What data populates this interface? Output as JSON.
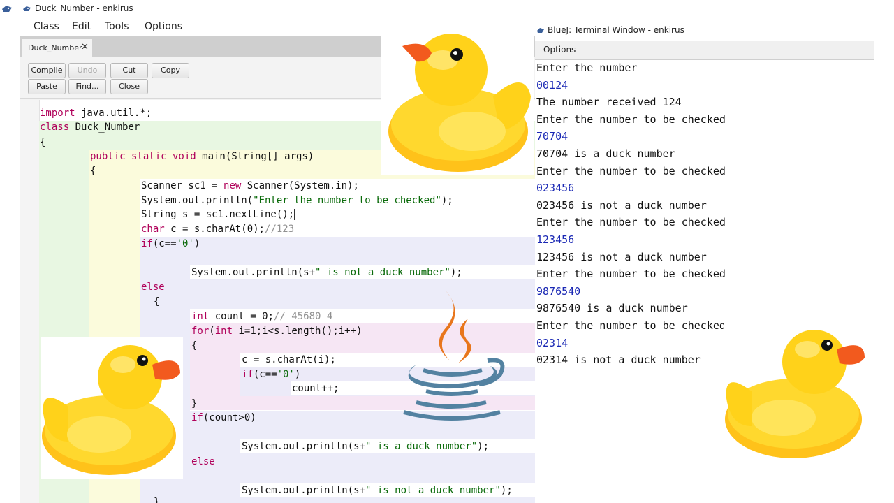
{
  "editor": {
    "window_title": "Duck_Number - enkirus",
    "menu": [
      "Class",
      "Edit",
      "Tools",
      "Options"
    ],
    "tab": {
      "label": "Duck_Number",
      "close_glyph": "✕"
    },
    "toolbar": {
      "compile": "Compile",
      "undo": "Undo",
      "cut": "Cut",
      "copy": "Copy",
      "paste": "Paste",
      "find": "Find...",
      "close": "Close"
    },
    "code": {
      "l1": {
        "kw": "import",
        "rest": " java.util.*;"
      },
      "l2": {
        "kw": "class",
        "rest": " Duck_Number"
      },
      "l3": "{",
      "l4": {
        "kw": "public static void",
        "rest": " main(String[] args)"
      },
      "l5": "{",
      "l6": {
        "a": "Scanner sc1 = ",
        "kw": "new",
        "b": " Scanner(System.in);"
      },
      "l7": {
        "a": "System.out.println(",
        "str": "\"Enter the number to be checked\"",
        "b": ");"
      },
      "l8": "String s = sc1.nextLine();",
      "l9": {
        "kw": "char",
        "a": " c = s.charAt(0);",
        "cm": "//123"
      },
      "l10": {
        "kw": "if",
        "a": "(c==",
        "str": "'0'",
        "b": ")"
      },
      "l11": {
        "a": "System.out.println(s+",
        "str": "\" is not a duck number\"",
        "b": ");"
      },
      "l12": {
        "kw": "else"
      },
      "l13": "{",
      "l14": {
        "kw": "int",
        "a": " count = 0;",
        "cm": "// 45680 4"
      },
      "l15": {
        "kw": "for",
        "a": "(",
        "kw2": "int",
        "b": " i=1;i<s.length();i++)"
      },
      "l16": "{",
      "l17": "c = s.charAt(i);",
      "l18": {
        "kw": "if",
        "a": "(c==",
        "str": "'0'",
        "b": ")"
      },
      "l19": "count++;",
      "l20": "}",
      "l21": {
        "kw": "if",
        "a": "(count>0)"
      },
      "l22": {
        "a": "System.out.println(s+",
        "str": "\" is a duck number\"",
        "b": ");"
      },
      "l23": {
        "kw": "else"
      },
      "l24": {
        "a": "System.out.println(s+",
        "str": "\" is not a duck number\"",
        "b": ");"
      },
      "l25": "}"
    }
  },
  "terminal": {
    "window_title": "BlueJ: Terminal Window - enkirus",
    "menu_options": "Options",
    "lines": [
      {
        "text": "Enter the number",
        "kind": "output"
      },
      {
        "text": "00124",
        "kind": "input"
      },
      {
        "text": "The number received 124",
        "kind": "output"
      },
      {
        "text": "Enter the number to be checked",
        "kind": "output"
      },
      {
        "text": "70704",
        "kind": "input"
      },
      {
        "text": "70704 is a duck number",
        "kind": "output"
      },
      {
        "text": "Enter the number to be checked",
        "kind": "output"
      },
      {
        "text": "023456",
        "kind": "input"
      },
      {
        "text": "023456 is not a duck number",
        "kind": "output"
      },
      {
        "text": "Enter the number to be checked",
        "kind": "output"
      },
      {
        "text": "123456",
        "kind": "input"
      },
      {
        "text": "123456 is not a duck number",
        "kind": "output"
      },
      {
        "text": "Enter the number to be checked",
        "kind": "output"
      },
      {
        "text": "9876540",
        "kind": "input"
      },
      {
        "text": "9876540 is a duck number",
        "kind": "output"
      },
      {
        "text": "Enter the number to be checked",
        "kind": "output"
      },
      {
        "text": "02314",
        "kind": "input"
      },
      {
        "text": "02314 is not a duck number",
        "kind": "output"
      }
    ]
  },
  "colors": {
    "keyword": "#b0005a",
    "string": "#0a6a0a",
    "comment": "#909090",
    "terminal_input": "#1a28b4",
    "duck_body": "#ffd21a",
    "duck_beak": "#f25a1e",
    "java_flame": "#e8761c",
    "java_cup": "#5382a1"
  },
  "overlays": {
    "icons": [
      "rubber-duck-icon",
      "java-logo-icon",
      "bluej-icon"
    ]
  }
}
